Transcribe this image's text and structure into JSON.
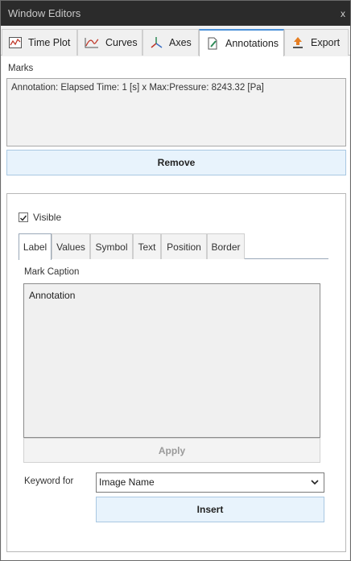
{
  "window": {
    "title": "Window Editors",
    "close_label": "x"
  },
  "tabs": [
    {
      "label": "Time Plot",
      "icon": "time-plot-icon"
    },
    {
      "label": "Curves",
      "icon": "curves-icon"
    },
    {
      "label": "Axes",
      "icon": "axes-icon"
    },
    {
      "label": "Annotations",
      "icon": "annotations-icon",
      "active": true
    },
    {
      "label": "Export",
      "icon": "export-icon"
    }
  ],
  "marks": {
    "label": "Marks",
    "items": [
      "Annotation: Elapsed Time: 1 [s] x Max:Pressure: 8243.32 [Pa]"
    ],
    "remove_label": "Remove"
  },
  "editor": {
    "visible_label": "Visible",
    "visible_checked": true,
    "subtabs": [
      "Label",
      "Values",
      "Symbol",
      "Text",
      "Position",
      "Border"
    ],
    "active_subtab": "Label",
    "caption_label": "Mark Caption",
    "caption_value": "Annotation",
    "apply_label": "Apply",
    "keyword_label": "Keyword for",
    "keyword_selected": "Image Name",
    "insert_label": "Insert"
  },
  "colors": {
    "accent": "#4a90d9",
    "button_bg": "#e8f3fc",
    "titlebar": "#2b2b2b"
  }
}
